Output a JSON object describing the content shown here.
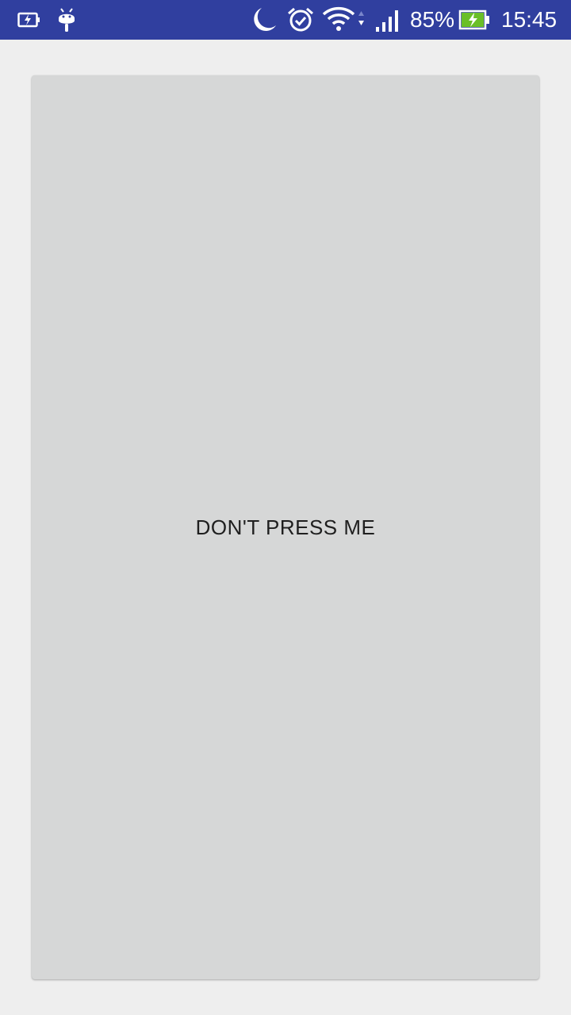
{
  "status_bar": {
    "background_color": "#303f9f",
    "left_icons": [
      "battery-saver-icon",
      "android-debug-icon"
    ],
    "right_icons": [
      "do-not-disturb-moon-icon",
      "alarm-icon",
      "wifi-icon",
      "cell-signal-icon",
      "battery-charging-icon"
    ],
    "battery_percent": "85%",
    "time": "15:45"
  },
  "main": {
    "button_label": "DON'T PRESS ME",
    "button_color": "#d6d7d7",
    "background_color": "#eeeeee"
  }
}
